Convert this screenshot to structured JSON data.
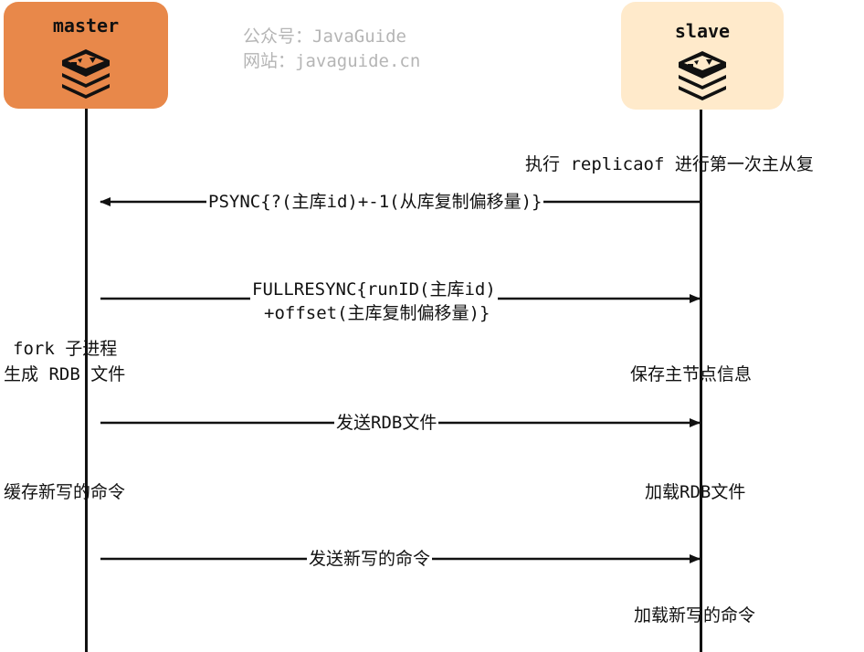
{
  "watermark": {
    "line1": "公众号：JavaGuide",
    "line2": "网站：javaguide.cn"
  },
  "master": {
    "title": "master",
    "icon": "redis-logo-icon"
  },
  "slave": {
    "title": "slave",
    "icon": "redis-logo-icon"
  },
  "messages": [
    {
      "id": "psync",
      "direction": "slave-to-master",
      "lines": [
        "PSYNC{?(主库id)+-1(从库复制偏移量)}"
      ]
    },
    {
      "id": "fullresync",
      "direction": "master-to-slave",
      "lines": [
        "FULLRESYNC{runID(主库id)",
        "+offset(主库复制偏移量)}"
      ]
    },
    {
      "id": "send-rdb",
      "direction": "master-to-slave",
      "lines": [
        "发送RDB文件"
      ]
    },
    {
      "id": "send-new-commands",
      "direction": "master-to-slave",
      "lines": [
        "发送新写的命令"
      ]
    }
  ],
  "notes": {
    "slave_replicaof": "执行 replicaof 进行第一次主从复",
    "master_fork_line1": "fork 子进程",
    "master_fork_line2": "生成 RDB 文件",
    "slave_save_info": "保存主节点信息",
    "master_buffer": "缓存新写的命令",
    "slave_load_rdb": "加载RDB文件",
    "slave_load_commands": "加载新写的命令"
  }
}
